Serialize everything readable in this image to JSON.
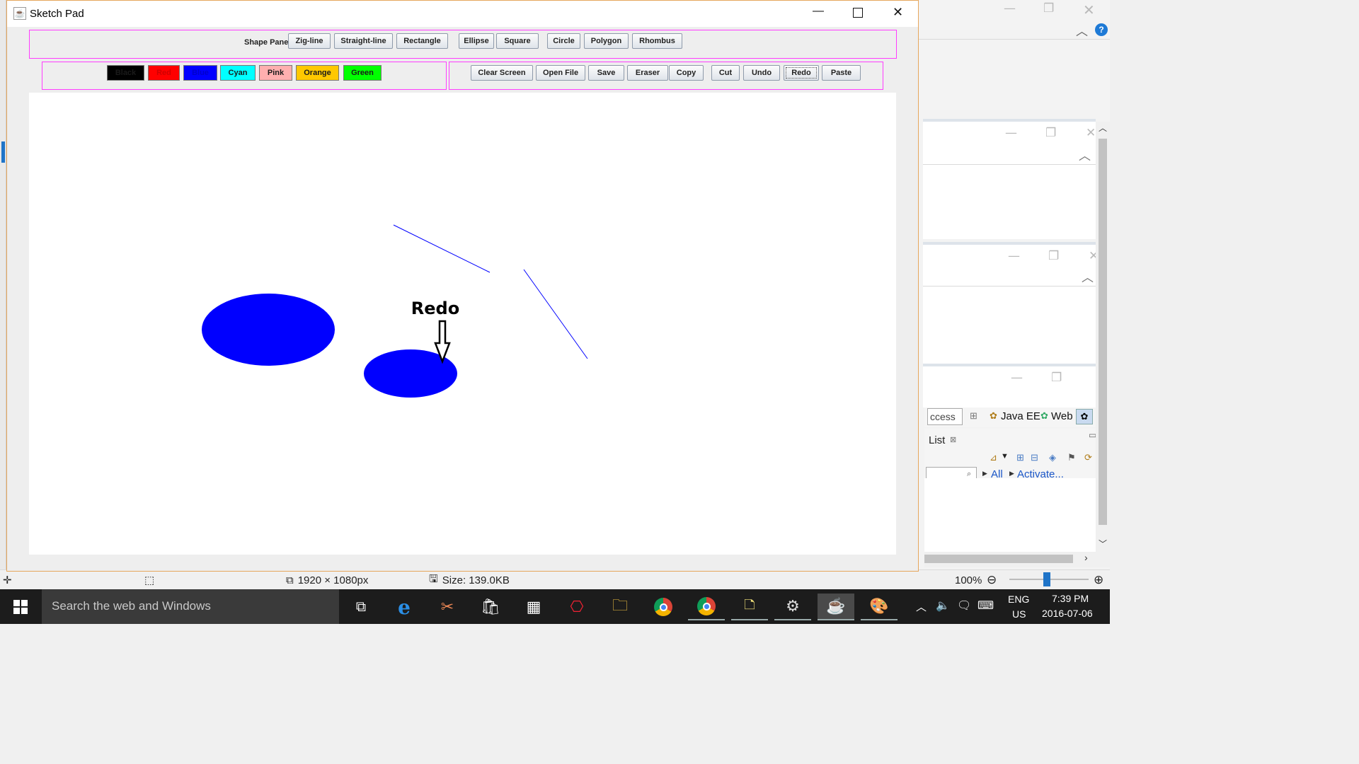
{
  "window": {
    "title": "Sketch Pad"
  },
  "shape_panel": {
    "label": "Shape Panel",
    "buttons": [
      "Zig-line",
      "Straight-line",
      "Rectangle",
      "Ellipse",
      "Square",
      "Circle",
      "Polygon",
      "Rhombus"
    ]
  },
  "colors": [
    {
      "label": "Black",
      "bg": "#000000",
      "fg": "#1a1a1a"
    },
    {
      "label": "Red",
      "bg": "#ff0000",
      "fg": "#d00000"
    },
    {
      "label": "Blue",
      "bg": "#0000ff",
      "fg": "#0000cc"
    },
    {
      "label": "Cyan",
      "bg": "#00ffff",
      "fg": "#1a1a1a"
    },
    {
      "label": "Pink",
      "bg": "#ffafaf",
      "fg": "#1a1a1a"
    },
    {
      "label": "Orange",
      "bg": "#ffc800",
      "fg": "#1a1a1a"
    },
    {
      "label": "Green",
      "bg": "#00ff00",
      "fg": "#1a1a1a"
    }
  ],
  "actions": [
    "Clear Screen",
    "Open File",
    "Save",
    "Eraser",
    "Copy",
    "Cut",
    "Undo",
    "Redo",
    "Paste"
  ],
  "canvas": {
    "annotation": "Redo",
    "draw_color": "#0000ff"
  },
  "statusbar": {
    "dimensions": "1920 × 1080px",
    "size": "Size: 139.0KB",
    "zoom": "100%"
  },
  "taskbar": {
    "search_placeholder": "Search the web and Windows",
    "lang_top": "ENG",
    "lang_bottom": "US",
    "time": "7:39 PM",
    "date": "2016-07-06"
  },
  "eclipse": {
    "quick_access": "ccess",
    "perspective_java_ee": "Java EE",
    "perspective_web": "Web",
    "view_tab": "List",
    "link_all": "All",
    "link_activate": "Activate..."
  }
}
